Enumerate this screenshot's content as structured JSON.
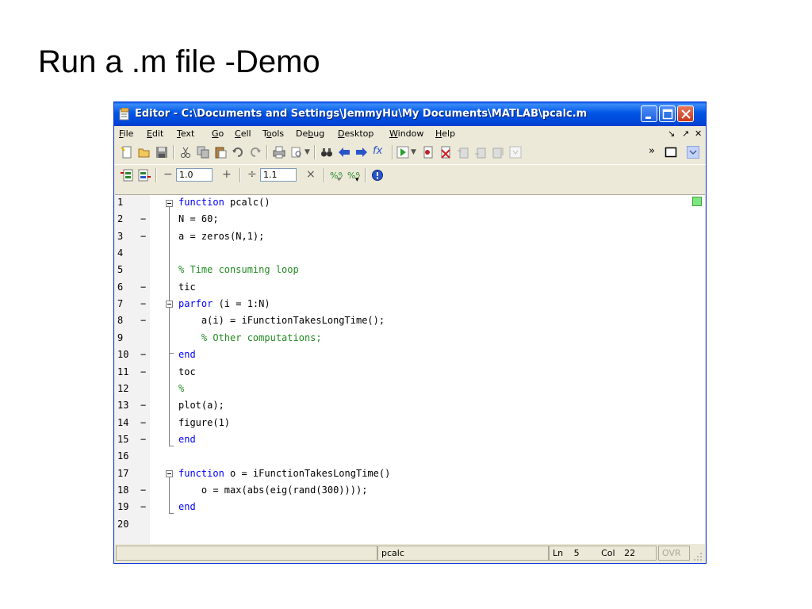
{
  "slide": {
    "title": "Run a .m file -Demo"
  },
  "window": {
    "title": "Editor - C:\\Documents and Settings\\JemmyHu\\My Documents\\MATLAB\\pcalc.m",
    "controls": {
      "minimize": "minimize",
      "maximize": "maximize",
      "close": "close"
    }
  },
  "menu": {
    "items": [
      {
        "u": "F",
        "rest": "ile"
      },
      {
        "u": "E",
        "rest": "dit"
      },
      {
        "u": "T",
        "rest": "ext"
      },
      {
        "u": "G",
        "rest": "o"
      },
      {
        "u": "C",
        "rest": "ell"
      },
      {
        "pre": "T",
        "u": "o",
        "rest": "ols"
      },
      {
        "pre": "De",
        "u": "b",
        "rest": "ug"
      },
      {
        "u": "D",
        "rest": "esktop"
      },
      {
        "u": "W",
        "rest": "indow"
      },
      {
        "u": "H",
        "rest": "elp"
      }
    ],
    "right_controls": [
      "↘",
      "↗",
      "✕"
    ]
  },
  "toolbar2": {
    "minus": "−",
    "field1_value": "1.0",
    "plus": "+",
    "divide": "÷",
    "field2_value": "1.1",
    "times": "×"
  },
  "code_lines": [
    {
      "num": "1",
      "dash": "",
      "html": "<span class='kw'>function</span> pcalc()"
    },
    {
      "num": "2",
      "dash": "−",
      "html": "N = 60;"
    },
    {
      "num": "3",
      "dash": "−",
      "html": "a = zeros(N,1);"
    },
    {
      "num": "4",
      "dash": "",
      "html": ""
    },
    {
      "num": "5",
      "dash": "",
      "html": "<span class='cm'>% Time consuming loop</span>"
    },
    {
      "num": "6",
      "dash": "−",
      "html": "tic"
    },
    {
      "num": "7",
      "dash": "−",
      "html": "<span class='kw'>parfor</span> (i = 1:N)"
    },
    {
      "num": "8",
      "dash": "−",
      "html": "    a(i) = iFunctionTakesLongTime();"
    },
    {
      "num": "9",
      "dash": "",
      "html": "    <span class='cm'>% Other computations;</span>"
    },
    {
      "num": "10",
      "dash": "−",
      "html": "<span class='kw'>end</span>"
    },
    {
      "num": "11",
      "dash": "−",
      "html": "toc"
    },
    {
      "num": "12",
      "dash": "",
      "html": "<span class='cm'>%</span>"
    },
    {
      "num": "13",
      "dash": "−",
      "html": "plot(a);"
    },
    {
      "num": "14",
      "dash": "−",
      "html": "figure(1)"
    },
    {
      "num": "15",
      "dash": "−",
      "html": "<span class='kw'>end</span>"
    },
    {
      "num": "16",
      "dash": "",
      "html": ""
    },
    {
      "num": "17",
      "dash": "",
      "html": "<span class='kw'>function</span> o = iFunctionTakesLongTime()"
    },
    {
      "num": "18",
      "dash": "−",
      "html": "    o = max(abs(eig(rand(300))));"
    },
    {
      "num": "19",
      "dash": "−",
      "html": "<span class='kw'>end</span>"
    },
    {
      "num": "20",
      "dash": "",
      "html": ""
    }
  ],
  "status": {
    "file": "pcalc",
    "ln_label": "Ln",
    "ln": "5",
    "col_label": "Col",
    "col": "22",
    "mode": "OVR"
  },
  "colors": {
    "keyword": "#0000FF",
    "comment": "#228B22",
    "titlebar": "#0055E5"
  }
}
